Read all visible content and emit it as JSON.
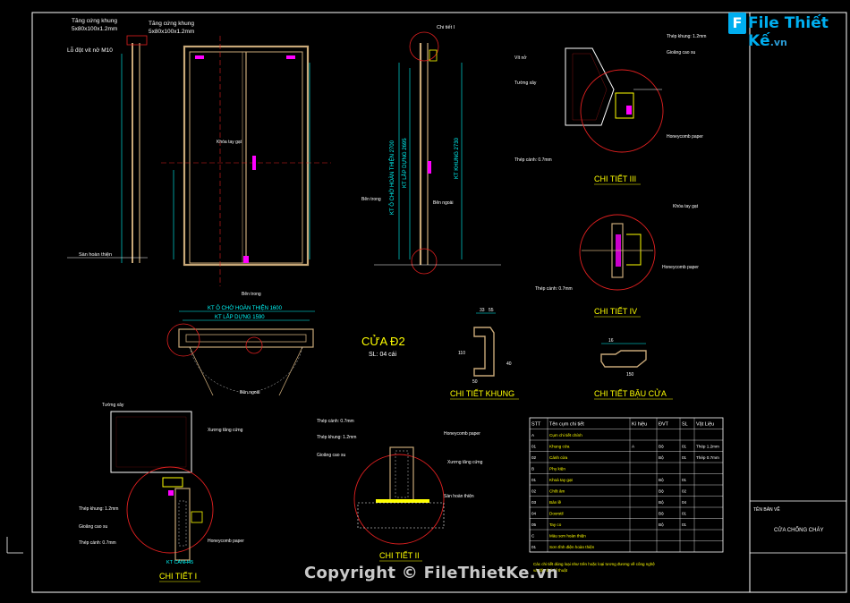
{
  "drawing": {
    "title": "CỬA  Đ2",
    "subtitle": "SL: 04 cái",
    "label_detail_1": "CHI TIẾT I",
    "label_detail_2": "CHI TIẾT II",
    "label_detail_3": "CHI TIẾT III",
    "label_detail_4": "CHI TIẾT IV",
    "label_frame": "CHI TIẾT KHUNG",
    "label_leaf": "CHI TIẾT BẬU CỬA",
    "dim_finish_width": "KT Ô CHỜ HOÀN THIỆN 1600",
    "dim_install_width": "KT LẮP DỰNG 1590",
    "dim_finish_height": "KT Ô CHỜ HOÀN THIỆN 2700",
    "dim_install_height": "KT LẮP DỰNG 2695",
    "dim_frame_height": "KT KHUNG 2730",
    "note_rebar_1": "Tăng cứng khung",
    "note_rebar_1b": "5x80x100x1.2mm",
    "note_rebar_2": "Tăng cứng khung",
    "note_rebar_2b": "5x80x100x1.2mm",
    "note_bolt": "Lỗ đột vít nở M10",
    "note_panic": "Khóa tay gạt",
    "note_inside": "Bên trong",
    "note_outside": "Bên ngoài",
    "note_floor": "Sàn hoàn thiện",
    "note_detail_ref": "Chi tiết I",
    "note_wall": "Tường xây",
    "note_sheet_12": "Thép khung: 1.2mm",
    "note_sheet_07": "Thép cánh: 0.7mm",
    "note_honeycomb": "Honeycomb paper",
    "note_gasket": "Gioăng cao su",
    "note_screw": "Vít nở",
    "note_brace": "Xương tăng cứng",
    "note_frame_kt": "KT CÁNH45",
    "dim_a": "33",
    "dim_b": "55",
    "dim_c": "110",
    "dim_d": "50",
    "dim_e": "40",
    "dim_f": "16",
    "dim_g": "150",
    "watermark": "Copyright © FileThietKe.vn",
    "logo_main": "File Thiết Kế",
    "logo_sub": ".vn"
  },
  "table": {
    "headers": [
      "STT",
      "Tên cụm chi tiết",
      "Kí hiệu",
      "ĐVT",
      "SL",
      "Vật Liệu"
    ],
    "rows": [
      [
        "A",
        "Cụm chi tiết chính",
        "",
        "",
        "",
        ""
      ],
      [
        "01",
        "Khung cửa",
        "A",
        "Bộ",
        "01",
        "Thép 1.2mm"
      ],
      [
        "02",
        "Cánh cửa",
        "",
        "Bộ",
        "01",
        "Thép 0.7mm"
      ],
      [
        "B",
        "Phụ kiện",
        "",
        "",
        "",
        ""
      ],
      [
        "01",
        "Khoá tay gạt",
        "",
        "Bộ",
        "01",
        ""
      ],
      [
        "02",
        "Chốt âm",
        "",
        "Bộ",
        "02",
        ""
      ],
      [
        "03",
        "Bản lề",
        "",
        "Bộ",
        "04",
        ""
      ],
      [
        "04",
        "Doorstil",
        "",
        "Bộ",
        "01",
        ""
      ],
      [
        "05",
        "Tay co",
        "",
        "Bộ",
        "01",
        ""
      ],
      [
        "C",
        "Màu sơn hoàn thiện",
        "",
        "",
        "",
        ""
      ],
      [
        "01",
        "Sơn tĩnh điện hoàn thiện",
        "",
        "",
        "",
        ""
      ]
    ],
    "footnote_1": "Các chi tiết dùng loại như trên hoặc loại tương đương về công nghệ",
    "footnote_2": "và đặc tính kĩ thuật"
  },
  "titleblock": {
    "label": "TÊN BẢN VẼ",
    "value": "CỬA CHỐNG CHÁY"
  },
  "colors": {
    "frame": "#ffffff",
    "door": "#c8a878",
    "detail_circle": "#e02020",
    "label": "#ffff00",
    "dim": "#00ffff",
    "accent": "#ff00ff",
    "green": "#00ff00"
  }
}
